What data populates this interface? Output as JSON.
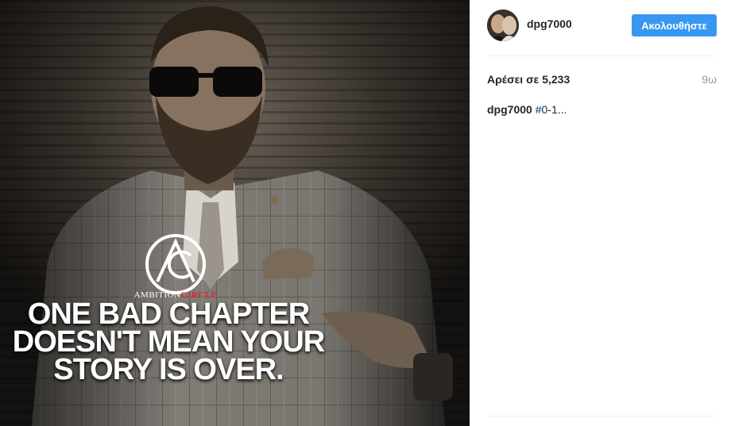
{
  "photo": {
    "brand_prefix": "AMBITION",
    "brand_suffix": "CIRCLE",
    "quote_lines": [
      "ONE BAD CHAPTER",
      "DOESN'T MEAN YOUR",
      "STORY IS OVER."
    ]
  },
  "post": {
    "username": "dpg7000",
    "follow_label": "Ακολουθήστε",
    "likes_text": "Αρέσει σε 5,233",
    "time_text": "9ω",
    "caption": {
      "username": "dpg7000",
      "hashtag": "#0",
      "rest": "-1..."
    }
  },
  "colors": {
    "follow_button": "#3897f0",
    "hashtag": "#003569",
    "brand_suffix": "#e0262e"
  }
}
